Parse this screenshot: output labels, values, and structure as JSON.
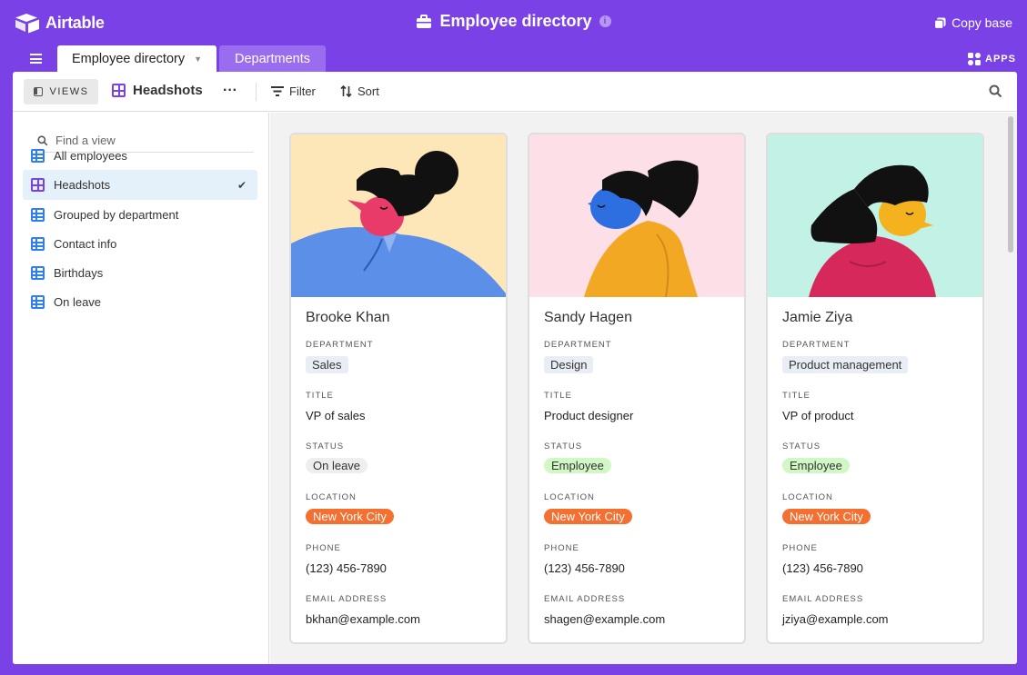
{
  "app": {
    "name": "Airtable",
    "base_title": "Employee directory",
    "copy_base": "Copy base",
    "apps_label": "APPS"
  },
  "tabs": [
    {
      "label": "Employee directory",
      "active": true
    },
    {
      "label": "Departments",
      "active": false
    }
  ],
  "toolbar": {
    "views_label": "VIEWS",
    "view_name": "Headshots",
    "filter_label": "Filter",
    "sort_label": "Sort"
  },
  "sidebar": {
    "search_placeholder": "Find a view",
    "items": [
      {
        "label": "All employees",
        "icon": "grid-view-icon",
        "selected": false
      },
      {
        "label": "Headshots",
        "icon": "gallery-view-icon",
        "selected": true
      },
      {
        "label": "Grouped by department",
        "icon": "grid-view-icon",
        "selected": false
      },
      {
        "label": "Contact info",
        "icon": "grid-view-icon",
        "selected": false
      },
      {
        "label": "Birthdays",
        "icon": "grid-view-icon",
        "selected": false
      },
      {
        "label": "On leave",
        "icon": "grid-view-icon",
        "selected": false
      }
    ]
  },
  "fields": {
    "department": "DEPARTMENT",
    "title": "TITLE",
    "status": "STATUS",
    "location": "LOCATION",
    "phone": "PHONE",
    "email": "EMAIL ADDRESS"
  },
  "cards": [
    {
      "name": "Brooke Khan",
      "department": "Sales",
      "title": "VP of sales",
      "status": "On leave",
      "location": "New York City",
      "phone": "(123) 456-7890",
      "email": "bkhan@example.com",
      "bg_color": "#fde7b8"
    },
    {
      "name": "Sandy Hagen",
      "department": "Design",
      "title": "Product designer",
      "status": "Employee",
      "location": "New York City",
      "phone": "(123) 456-7890",
      "email": "shagen@example.com",
      "bg_color": "#fcdfe7"
    },
    {
      "name": "Jamie Ziya",
      "department": "Product management",
      "title": "VP of product",
      "status": "Employee",
      "location": "New York City",
      "phone": "(123) 456-7890",
      "email": "jziya@example.com",
      "bg_color": "#c2f2e6"
    }
  ],
  "colors": {
    "brand": "#7a42e6",
    "location_pill": "#f56f30",
    "employee_pill": "#d1f7c4",
    "selected_view": "#e4f1fb"
  }
}
